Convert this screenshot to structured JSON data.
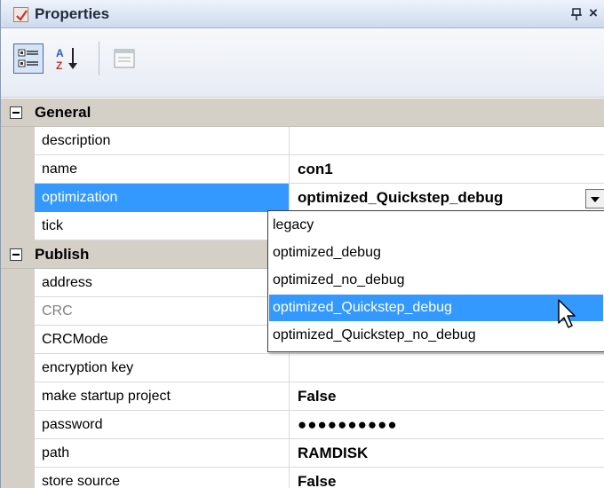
{
  "window": {
    "title": "Properties",
    "pin_glyph": "ᵖ",
    "close_glyph": "×",
    "title_icon": "properties-window-icon"
  },
  "toolbar": {
    "buttons": [
      "categorized-icon",
      "alphabetical-sort-icon",
      "property-pages-icon"
    ]
  },
  "categories": [
    {
      "label": "General",
      "properties": [
        {
          "name": "description",
          "value": ""
        },
        {
          "name": "name",
          "value": "con1"
        },
        {
          "name": "optimization",
          "value": "optimized_Quickstep_debug"
        },
        {
          "name": "tick",
          "value": ""
        }
      ]
    },
    {
      "label": "Publish",
      "properties": [
        {
          "name": "address",
          "value": ""
        },
        {
          "name": "CRC",
          "value": ""
        },
        {
          "name": "CRCMode",
          "value": ""
        },
        {
          "name": "encryption key",
          "value": ""
        },
        {
          "name": "make startup project",
          "value": "False"
        },
        {
          "name": "password",
          "value": "●●●●●●●●●●"
        },
        {
          "name": "path",
          "value": "RAMDISK"
        },
        {
          "name": "store source",
          "value": "False"
        }
      ]
    }
  ],
  "dropdown": {
    "options": [
      "legacy",
      "optimized_debug",
      "optimized_no_debug",
      "optimized_Quickstep_debug",
      "optimized_Quickstep_no_debug"
    ],
    "highlighted": "optimized_Quickstep_debug"
  },
  "colors": {
    "selection": "#3399ff",
    "category_bg": "#d4d0c8",
    "title_gradient_top": "#eef3fb",
    "title_gradient_bottom": "#cddaee"
  }
}
